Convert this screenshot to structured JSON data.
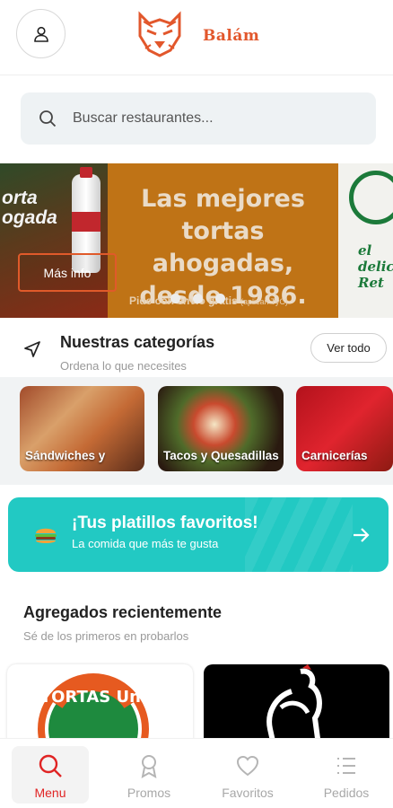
{
  "header": {
    "brand": "Balám",
    "logo_icon": "jaguar-logo-icon",
    "profile_icon": "user-icon"
  },
  "search": {
    "placeholder": "Buscar restaurantes...",
    "icon": "search-icon"
  },
  "banner": {
    "photo_text_line1": "orta",
    "photo_text_line2": "ogada",
    "title_line1": "Las mejores",
    "title_line2": "tortas ahogadas,",
    "title_line3": "desde 1986.",
    "subtitle": "Pide con envío gratis",
    "subtitle_note": "(aplican TyC)",
    "more_button": "Más info",
    "next_text_line1": "el",
    "next_text_line2": "delicio",
    "next_text_line3": "Ret",
    "dot_count": 3
  },
  "categories": {
    "title": "Nuestras categorías",
    "subtitle": "Ordena lo que necesites",
    "see_all": "Ver todo",
    "items": [
      {
        "label": "Sándwiches y"
      },
      {
        "label": "Tacos y Quesadillas"
      },
      {
        "label": "Carnicerías"
      }
    ]
  },
  "favorites": {
    "title": "¡Tus platillos favoritos!",
    "subtitle": "La comida que más te gusta",
    "icon": "burger-icon",
    "arrow_icon": "arrow-right-icon"
  },
  "recent": {
    "title": "Agregados recientemente",
    "subtitle": "Sé de los primeros en probarlos",
    "restaurants": [
      {
        "name": "TORTAS Uni"
      },
      {
        "name": "rooster-logo"
      }
    ]
  },
  "nav": {
    "items": [
      {
        "label": "Menu",
        "icon": "search-icon",
        "active": true
      },
      {
        "label": "Promos",
        "icon": "award-icon",
        "active": false
      },
      {
        "label": "Favoritos",
        "icon": "heart-icon",
        "active": false
      },
      {
        "label": "Pedidos",
        "icon": "list-icon",
        "active": false
      }
    ]
  },
  "colors": {
    "accent": "#e02424",
    "brand": "#e2572c",
    "teal": "#22c9c3",
    "banner": "#bf7316"
  }
}
